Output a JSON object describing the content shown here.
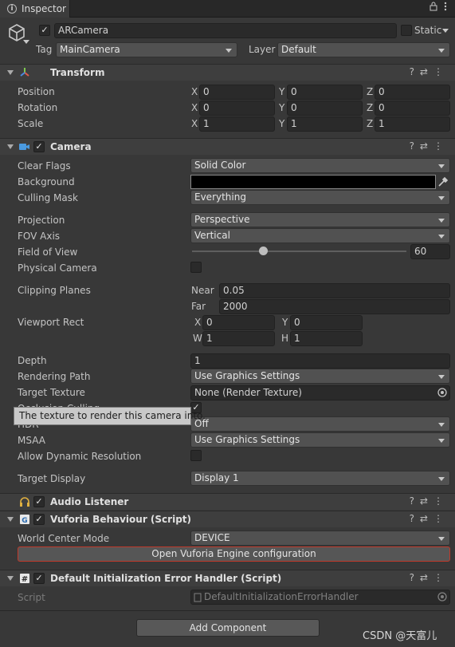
{
  "window": {
    "tab_title": "Inspector"
  },
  "gameobject": {
    "name": "ARCamera",
    "static_label": "Static",
    "tag_label": "Tag",
    "tag_value": "MainCamera",
    "layer_label": "Layer",
    "layer_value": "Default"
  },
  "transform": {
    "title": "Transform",
    "position_label": "Position",
    "rotation_label": "Rotation",
    "scale_label": "Scale",
    "x": "X",
    "y": "Y",
    "z": "Z",
    "position": [
      "0",
      "0",
      "0"
    ],
    "rotation": [
      "0",
      "0",
      "0"
    ],
    "scale": [
      "1",
      "1",
      "1"
    ]
  },
  "camera": {
    "title": "Camera",
    "clear_flags_label": "Clear Flags",
    "clear_flags_value": "Solid Color",
    "background_label": "Background",
    "background_color": "#000000",
    "culling_mask_label": "Culling Mask",
    "culling_mask_value": "Everything",
    "projection_label": "Projection",
    "projection_value": "Perspective",
    "fov_axis_label": "FOV Axis",
    "fov_axis_value": "Vertical",
    "fov_label": "Field of View",
    "fov_value": "60",
    "fov_slider_fraction": 0.33,
    "physical_camera_label": "Physical Camera",
    "clipping_planes_label": "Clipping Planes",
    "near_label": "Near",
    "near_value": "0.05",
    "far_label": "Far",
    "far_value": "2000",
    "viewport_rect_label": "Viewport Rect",
    "vp_x_label": "X",
    "vp_x_value": "0",
    "vp_y_label": "Y",
    "vp_y_value": "0",
    "vp_w_label": "W",
    "vp_w_value": "1",
    "vp_h_label": "H",
    "vp_h_value": "1",
    "depth_label": "Depth",
    "depth_value": "1",
    "rendering_path_label": "Rendering Path",
    "rendering_path_value": "Use Graphics Settings",
    "target_texture_label": "Target Texture",
    "target_texture_value": "None (Render Texture)",
    "occlusion_culling_label": "Occlusion Culling",
    "hdr_label": "HDR",
    "hdr_value": "Off",
    "msaa_label": "MSAA",
    "msaa_value": "Use Graphics Settings",
    "dynamic_res_label": "Allow Dynamic Resolution",
    "target_display_label": "Target Display",
    "target_display_value": "Display 1",
    "tooltip": "The texture to render this camera into."
  },
  "audio_listener": {
    "title": "Audio Listener"
  },
  "vuforia": {
    "title": "Vuforia Behaviour (Script)",
    "world_center_mode_label": "World Center Mode",
    "world_center_mode_value": "DEVICE",
    "open_config_button": "Open Vuforia Engine configuration"
  },
  "error_handler": {
    "title": "Default Initialization Error Handler (Script)",
    "script_label": "Script",
    "script_value": "DefaultInitializationErrorHandler"
  },
  "add_component_button": "Add Component",
  "watermark": "CSDN @天富儿",
  "colors": {
    "accent_blue": "#3a79bb",
    "button_outline_red": "#c0392b"
  }
}
